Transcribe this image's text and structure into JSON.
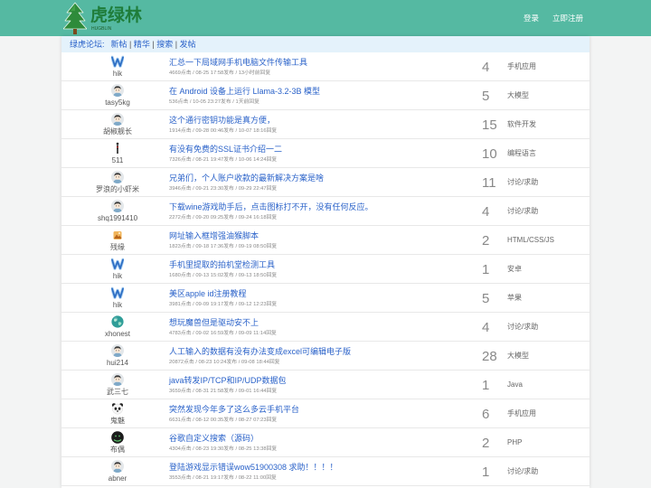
{
  "header": {
    "logo_icon": "tree-logo-icon",
    "logo_title": "虎绿林",
    "logo_subtitle": "HUGBLIN",
    "login_label": "登录",
    "register_label": "立即注册"
  },
  "breadcrumb": {
    "forum_label": "绿虎论坛:",
    "separator": "|",
    "links": [
      "新帖",
      "精华",
      "搜索",
      "发帖"
    ]
  },
  "colors": {
    "header_bg": "#55b9a2",
    "link": "#2a62c9",
    "breadcrumb_bg": "#e4f2fb",
    "logo_text": "#1f7d3a"
  },
  "threads": [
    {
      "author": "hik",
      "avatar": "w-logo-avatar",
      "title": "汇总一下局域网手机电脑文件传输工具",
      "meta": "4669点击 / 08-25 17:58发布 / 13小时前回复",
      "replies": 4,
      "category": "手机应用"
    },
    {
      "author": "tasy5kg",
      "avatar": "default-avatar",
      "title": "在 Android 设备上运行 Llama-3.2-3B 模型",
      "meta": "536点击 / 10-05 23:27发布 / 1天前回复",
      "replies": 5,
      "category": "大模型"
    },
    {
      "author": "胡椒舰长",
      "avatar": "default-avatar",
      "title": "这个通行密钥功能是真方便，",
      "meta": "1914点击 / 09-28 00:46发布 / 10-07 18:16回复",
      "replies": 15,
      "category": "软件开发"
    },
    {
      "author": "511",
      "avatar": "pixel-figure-avatar",
      "title": "有没有免费的SSL证书介绍一二",
      "meta": "7326点击 / 08-21 19:47发布 / 10-06 14:24回复",
      "replies": 10,
      "category": "编程语言"
    },
    {
      "author": "罗浪的小虾米",
      "avatar": "default-avatar",
      "title": "兄弟们，个人账户收款的最新解决方案是啥",
      "meta": "3946点击 / 09-21 23:30发布 / 09-29 22:47回复",
      "replies": 11,
      "category": "讨论/求助"
    },
    {
      "author": "shq1991410",
      "avatar": "default-avatar",
      "title": "下载wine游戏助手后，点击图标打不开，没有任何反应。",
      "meta": "2272点击 / 09-20 09:25发布 / 09-24 16:18回复",
      "replies": 4,
      "category": "讨论/求助"
    },
    {
      "author": "残缘",
      "avatar": "orange-image-avatar",
      "title": "网址输入框增强油猴脚本",
      "meta": "1823点击 / 09-18 17:36发布 / 09-19 08:50回复",
      "replies": 2,
      "category": "HTML/CSS/JS"
    },
    {
      "author": "hik",
      "avatar": "w-logo-avatar",
      "title": "手机里提取的拍机堂检测工具",
      "meta": "1680点击 / 09-13 15:02发布 / 09-13 18:50回复",
      "replies": 1,
      "category": "安卓"
    },
    {
      "author": "hik",
      "avatar": "w-logo-avatar",
      "title": "美区apple id注册教程",
      "meta": "3981点击 / 09-09 19:17发布 / 09-12 12:23回复",
      "replies": 5,
      "category": "苹果"
    },
    {
      "author": "xhonest",
      "avatar": "globe-avatar",
      "title": "想玩魔兽但是驱动安不上",
      "meta": "4783点击 / 09-02 16:59发布 / 09-09 11:14回复",
      "replies": 4,
      "category": "讨论/求助"
    },
    {
      "author": "hui214",
      "avatar": "default-avatar",
      "title": "人工输入的数据有没有办法变成excel可编辑电子版",
      "meta": "20872点击 / 08-23 10:24发布 / 09-08 18:44回复",
      "replies": 28,
      "category": "大模型"
    },
    {
      "author": "武三七",
      "avatar": "default-avatar",
      "title": "java转发IP/TCP和IP/UDP数据包",
      "meta": "3659点击 / 08-31 21:58发布 / 09-01 16:44回复",
      "replies": 1,
      "category": "Java"
    },
    {
      "author": "鬼魅",
      "avatar": "panda-avatar",
      "title": "突然发现今年多了这么多云手机平台",
      "meta": "6631点击 / 08-12 00:35发布 / 08-27 07:23回复",
      "replies": 6,
      "category": "手机应用"
    },
    {
      "author": "布偶",
      "avatar": "dark-circle-avatar",
      "title": "谷歌自定义搜索（源码）",
      "meta": "4304点击 / 08-23 19:30发布 / 08-25 13:38回复",
      "replies": 2,
      "category": "PHP"
    },
    {
      "author": "abner",
      "avatar": "default-avatar",
      "title": "登陆游戏显示错误wow51900308 求助！！！！",
      "meta": "3553点击 / 08-21 19:17发布 / 08-22 11:00回复",
      "replies": 1,
      "category": "讨论/求助"
    }
  ]
}
